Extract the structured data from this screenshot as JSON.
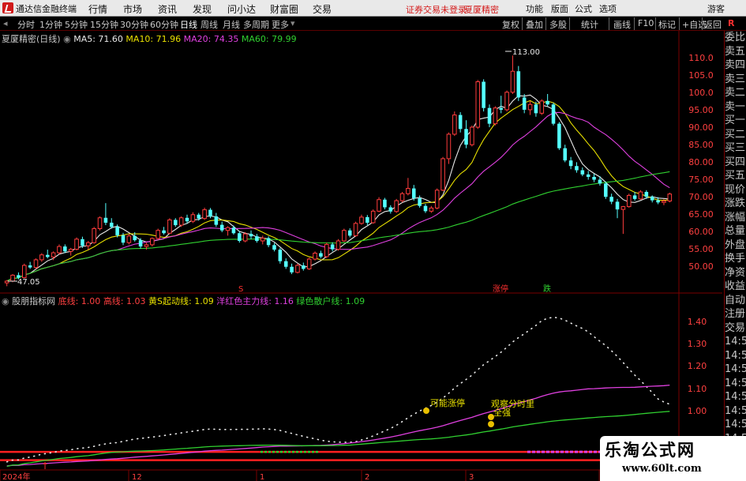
{
  "menubar": {
    "app_title": "通达信金融终端",
    "menus": [
      "行情",
      "市场",
      "资讯",
      "发现",
      "问小达",
      "财富圈",
      "交易"
    ],
    "notice": "证券交易未登录",
    "stock_name": "夏厦精密",
    "right_menus": [
      "功能",
      "版面",
      "公式",
      "选项"
    ],
    "guest": "游客"
  },
  "toolbar": {
    "periods": [
      "分时",
      "1分钟",
      "5分钟",
      "15分钟",
      "30分钟",
      "60分钟",
      "日线",
      "周线",
      "月线",
      "多周期",
      "更多"
    ],
    "active_period": "日线",
    "right_buttons": [
      "复权",
      "叠加",
      "多股",
      "统计",
      "画线",
      "F10",
      "标记",
      "+自选",
      "返回"
    ],
    "r_badge": "R"
  },
  "main_chart": {
    "title": "夏厦精密(日线)",
    "ma": [
      {
        "label": "MA5: 71.60",
        "color": "#e8e8e8"
      },
      {
        "label": "MA10: 71.96",
        "color": "#e8e000"
      },
      {
        "label": "MA20: 74.35",
        "color": "#e040e0"
      },
      {
        "label": "MA60: 79.99",
        "color": "#30d030"
      }
    ],
    "high_label": "113.00",
    "low_label": "47.05",
    "markers": [
      {
        "text": "S",
        "color": "#ff3030"
      },
      {
        "text": "涨停",
        "color": "#ff3030"
      },
      {
        "text": "跌",
        "color": "#30d030"
      }
    ],
    "axis_ticks": [
      "110.0",
      "105.0",
      "100.0",
      "95.00",
      "90.00",
      "85.00",
      "80.00",
      "75.00",
      "70.00",
      "65.00",
      "60.00",
      "55.00",
      "50.00"
    ]
  },
  "indicator": {
    "title": "股朋指标网",
    "legend": [
      {
        "label": "底线: 1.00",
        "color": "#ff4040"
      },
      {
        "label": "高线: 1.03",
        "color": "#ff4040"
      },
      {
        "label": "黄S起动线: 1.09",
        "color": "#e8e000"
      },
      {
        "label": "洋红色主力线: 1.16",
        "color": "#e040e0"
      },
      {
        "label": "绿色散户线: 1.09",
        "color": "#30d030"
      }
    ],
    "annotations": [
      "可能涨停",
      "观察分时里",
      "全强"
    ],
    "axis_ticks": [
      "1.40",
      "1.30",
      "1.20",
      "1.10",
      "1.00"
    ]
  },
  "x_axis": {
    "labels": [
      "2024年",
      "12",
      "1",
      "2",
      "3",
      "4"
    ]
  },
  "right_panel": {
    "items": [
      "委比",
      "卖五",
      "卖四",
      "卖三",
      "卖二",
      "卖一",
      "买一",
      "买二",
      "买三",
      "买四",
      "买五",
      "现价",
      "涨跌",
      "涨幅",
      "总量",
      "外盘",
      "换手",
      "净资",
      "收益",
      "自动",
      "注册",
      "交易",
      "14:5",
      "14:5",
      "14:5",
      "14:5",
      "14:5",
      "14:5",
      "14:5",
      "14:5",
      "14:5",
      "14:5"
    ]
  },
  "watermark": {
    "title": "乐淘公式网",
    "url": "www.60lt.com"
  },
  "chart_data": {
    "type": "candlestick",
    "title": "夏厦精密(日线)",
    "ylim": [
      46,
      116
    ],
    "x_labels": [
      "2024年",
      "12",
      "1",
      "2",
      "3",
      "4"
    ],
    "candles": [
      [
        48.0,
        48.8,
        47.05,
        48.5
      ],
      [
        48.5,
        50.5,
        48.2,
        50.2
      ],
      [
        50.2,
        51.0,
        49.0,
        49.5
      ],
      [
        49.5,
        53.5,
        49.3,
        53.0
      ],
      [
        53.0,
        54.0,
        52.0,
        52.4
      ],
      [
        52.4,
        55.0,
        52.0,
        54.6
      ],
      [
        54.6,
        56.5,
        54.0,
        56.0
      ],
      [
        56.0,
        57.5,
        55.0,
        55.4
      ],
      [
        55.4,
        57.0,
        54.5,
        56.6
      ],
      [
        56.6,
        59.0,
        56.2,
        58.4
      ],
      [
        58.4,
        59.0,
        56.5,
        57.0
      ],
      [
        57.0,
        58.0,
        55.8,
        57.6
      ],
      [
        57.6,
        61.0,
        57.3,
        60.5
      ],
      [
        60.5,
        61.2,
        58.0,
        58.6
      ],
      [
        58.6,
        60.0,
        57.5,
        59.5
      ],
      [
        59.5,
        64.0,
        59.2,
        63.5
      ],
      [
        63.5,
        67.0,
        63.0,
        66.6
      ],
      [
        66.6,
        70.8,
        64.5,
        65.2
      ],
      [
        65.2,
        66.5,
        63.5,
        64.0
      ],
      [
        64.0,
        64.7,
        61.0,
        61.6
      ],
      [
        61.6,
        62.3,
        58.8,
        59.5
      ],
      [
        59.5,
        62.0,
        59.0,
        61.4
      ],
      [
        61.4,
        62.5,
        59.8,
        60.2
      ],
      [
        60.2,
        60.8,
        57.8,
        58.4
      ],
      [
        58.4,
        59.5,
        57.5,
        58.9
      ],
      [
        58.9,
        61.0,
        58.4,
        60.7
      ],
      [
        60.7,
        63.5,
        60.3,
        63.0
      ],
      [
        63.0,
        64.0,
        61.8,
        62.2
      ],
      [
        62.2,
        66.5,
        62.0,
        66.0
      ],
      [
        66.0,
        66.5,
        64.0,
        64.5
      ],
      [
        64.5,
        67.0,
        64.0,
        66.6
      ],
      [
        66.6,
        67.5,
        65.0,
        65.6
      ],
      [
        65.6,
        68.2,
        65.1,
        67.5
      ],
      [
        67.5,
        68.0,
        65.8,
        66.4
      ],
      [
        66.4,
        69.5,
        66.0,
        68.9
      ],
      [
        68.9,
        69.4,
        66.5,
        67.0
      ],
      [
        67.0,
        68.0,
        64.0,
        64.6
      ],
      [
        64.6,
        65.5,
        62.5,
        63.0
      ],
      [
        63.0,
        64.2,
        61.5,
        63.8
      ],
      [
        63.8,
        64.4,
        61.8,
        62.2
      ],
      [
        62.2,
        62.8,
        59.5,
        60.0
      ],
      [
        60.0,
        62.5,
        59.6,
        62.0
      ],
      [
        62.0,
        63.0,
        60.5,
        61.3
      ],
      [
        61.3,
        62.0,
        59.5,
        60.0
      ],
      [
        60.0,
        61.5,
        59.0,
        60.8
      ],
      [
        60.8,
        61.3,
        58.2,
        58.8
      ],
      [
        58.8,
        59.4,
        57.0,
        57.5
      ],
      [
        57.5,
        58.0,
        53.5,
        54.2
      ],
      [
        54.2,
        55.0,
        52.0,
        52.6
      ],
      [
        52.6,
        53.5,
        50.5,
        51.0
      ],
      [
        51.0,
        53.5,
        50.7,
        53.0
      ],
      [
        53.0,
        53.8,
        51.5,
        52.0
      ],
      [
        52.0,
        55.2,
        51.7,
        54.8
      ],
      [
        54.8,
        57.0,
        54.4,
        56.5
      ],
      [
        56.5,
        57.2,
        55.0,
        55.5
      ],
      [
        55.5,
        59.5,
        55.1,
        59.0
      ],
      [
        59.0,
        59.6,
        57.0,
        57.6
      ],
      [
        57.6,
        60.5,
        57.2,
        60.0
      ],
      [
        60.0,
        63.5,
        59.7,
        63.0
      ],
      [
        63.0,
        63.6,
        61.0,
        61.5
      ],
      [
        61.5,
        65.5,
        61.2,
        65.0
      ],
      [
        65.0,
        67.5,
        64.6,
        66.8
      ],
      [
        66.8,
        67.4,
        64.5,
        65.2
      ],
      [
        65.2,
        69.0,
        64.9,
        68.5
      ],
      [
        68.5,
        72.5,
        68.2,
        71.8
      ],
      [
        71.8,
        72.3,
        69.0,
        69.6
      ],
      [
        69.6,
        70.2,
        67.8,
        68.4
      ],
      [
        68.4,
        72.0,
        68.0,
        71.5
      ],
      [
        71.5,
        74.0,
        71.0,
        73.5
      ],
      [
        73.5,
        78.0,
        73.0,
        75.0
      ],
      [
        75.0,
        76.0,
        71.5,
        72.2
      ],
      [
        72.2,
        73.0,
        69.5,
        70.0
      ],
      [
        70.0,
        70.6,
        68.0,
        68.5
      ],
      [
        68.5,
        70.0,
        68.0,
        69.4
      ],
      [
        69.4,
        75.0,
        69.0,
        74.5
      ],
      [
        74.5,
        84.0,
        74.2,
        83.5
      ],
      [
        83.5,
        91.0,
        82.0,
        90.5
      ],
      [
        90.5,
        97.0,
        90.0,
        96.0
      ],
      [
        96.0,
        96.8,
        91.0,
        92.0
      ],
      [
        92.0,
        94.5,
        86.5,
        87.5
      ],
      [
        87.5,
        93.0,
        87.0,
        92.5
      ],
      [
        92.5,
        106.0,
        92.0,
        105.5
      ],
      [
        105.5,
        106.2,
        97.0,
        98.0
      ],
      [
        98.0,
        99.0,
        92.5,
        93.5
      ],
      [
        93.5,
        98.5,
        93.0,
        98.0
      ],
      [
        98.0,
        101.5,
        96.5,
        97.5
      ],
      [
        97.5,
        103.0,
        97.0,
        102.5
      ],
      [
        102.5,
        113.0,
        102.0,
        108.5
      ],
      [
        108.5,
        110.0,
        100.0,
        101.0
      ],
      [
        101.0,
        102.0,
        96.5,
        97.5
      ],
      [
        97.5,
        100.0,
        96.0,
        99.0
      ],
      [
        99.0,
        99.8,
        95.5,
        96.5
      ],
      [
        96.5,
        100.5,
        96.0,
        100.0
      ],
      [
        100.0,
        102.0,
        98.5,
        99.0
      ],
      [
        99.0,
        99.5,
        93.0,
        93.5
      ],
      [
        93.5,
        94.0,
        86.0,
        86.5
      ],
      [
        86.5,
        87.5,
        82.5,
        83.0
      ],
      [
        83.0,
        84.0,
        80.5,
        81.4
      ],
      [
        81.4,
        82.5,
        79.5,
        80.2
      ],
      [
        80.2,
        81.0,
        78.5,
        79.0
      ],
      [
        79.0,
        80.0,
        77.5,
        78.3
      ],
      [
        78.3,
        79.2,
        76.8,
        77.5
      ],
      [
        77.5,
        78.5,
        75.8,
        76.4
      ],
      [
        76.4,
        77.0,
        72.0,
        72.6
      ],
      [
        72.6,
        73.5,
        70.5,
        71.2
      ],
      [
        71.2,
        72.0,
        66.5,
        69.0
      ],
      [
        69.0,
        70.0,
        62.0,
        69.8
      ],
      [
        69.8,
        73.5,
        69.5,
        73.0
      ],
      [
        73.0,
        74.0,
        71.5,
        72.0
      ],
      [
        72.0,
        74.5,
        71.8,
        74.0
      ],
      [
        74.0,
        74.5,
        72.0,
        72.6
      ],
      [
        72.6,
        73.0,
        71.0,
        71.6
      ],
      [
        71.6,
        72.5,
        70.5,
        71.0
      ],
      [
        71.0,
        72.0,
        70.2,
        71.4
      ],
      [
        71.4,
        73.8,
        71.0,
        73.4
      ]
    ],
    "series": [
      {
        "name": "MA5",
        "values": [
          71.6
        ]
      },
      {
        "name": "MA10",
        "values": [
          71.96
        ]
      },
      {
        "name": "MA20",
        "values": [
          74.35
        ]
      },
      {
        "name": "MA60",
        "values": [
          79.99
        ]
      }
    ],
    "indicator_series": [
      {
        "name": "底线",
        "value": 1.0
      },
      {
        "name": "高线",
        "value": 1.03
      },
      {
        "name": "黄S起动线",
        "value": 1.09
      },
      {
        "name": "洋红色主力线",
        "value": 1.16
      },
      {
        "name": "绿色散户线",
        "value": 1.09
      }
    ],
    "indicator_ylim": [
      0.98,
      1.46
    ]
  }
}
